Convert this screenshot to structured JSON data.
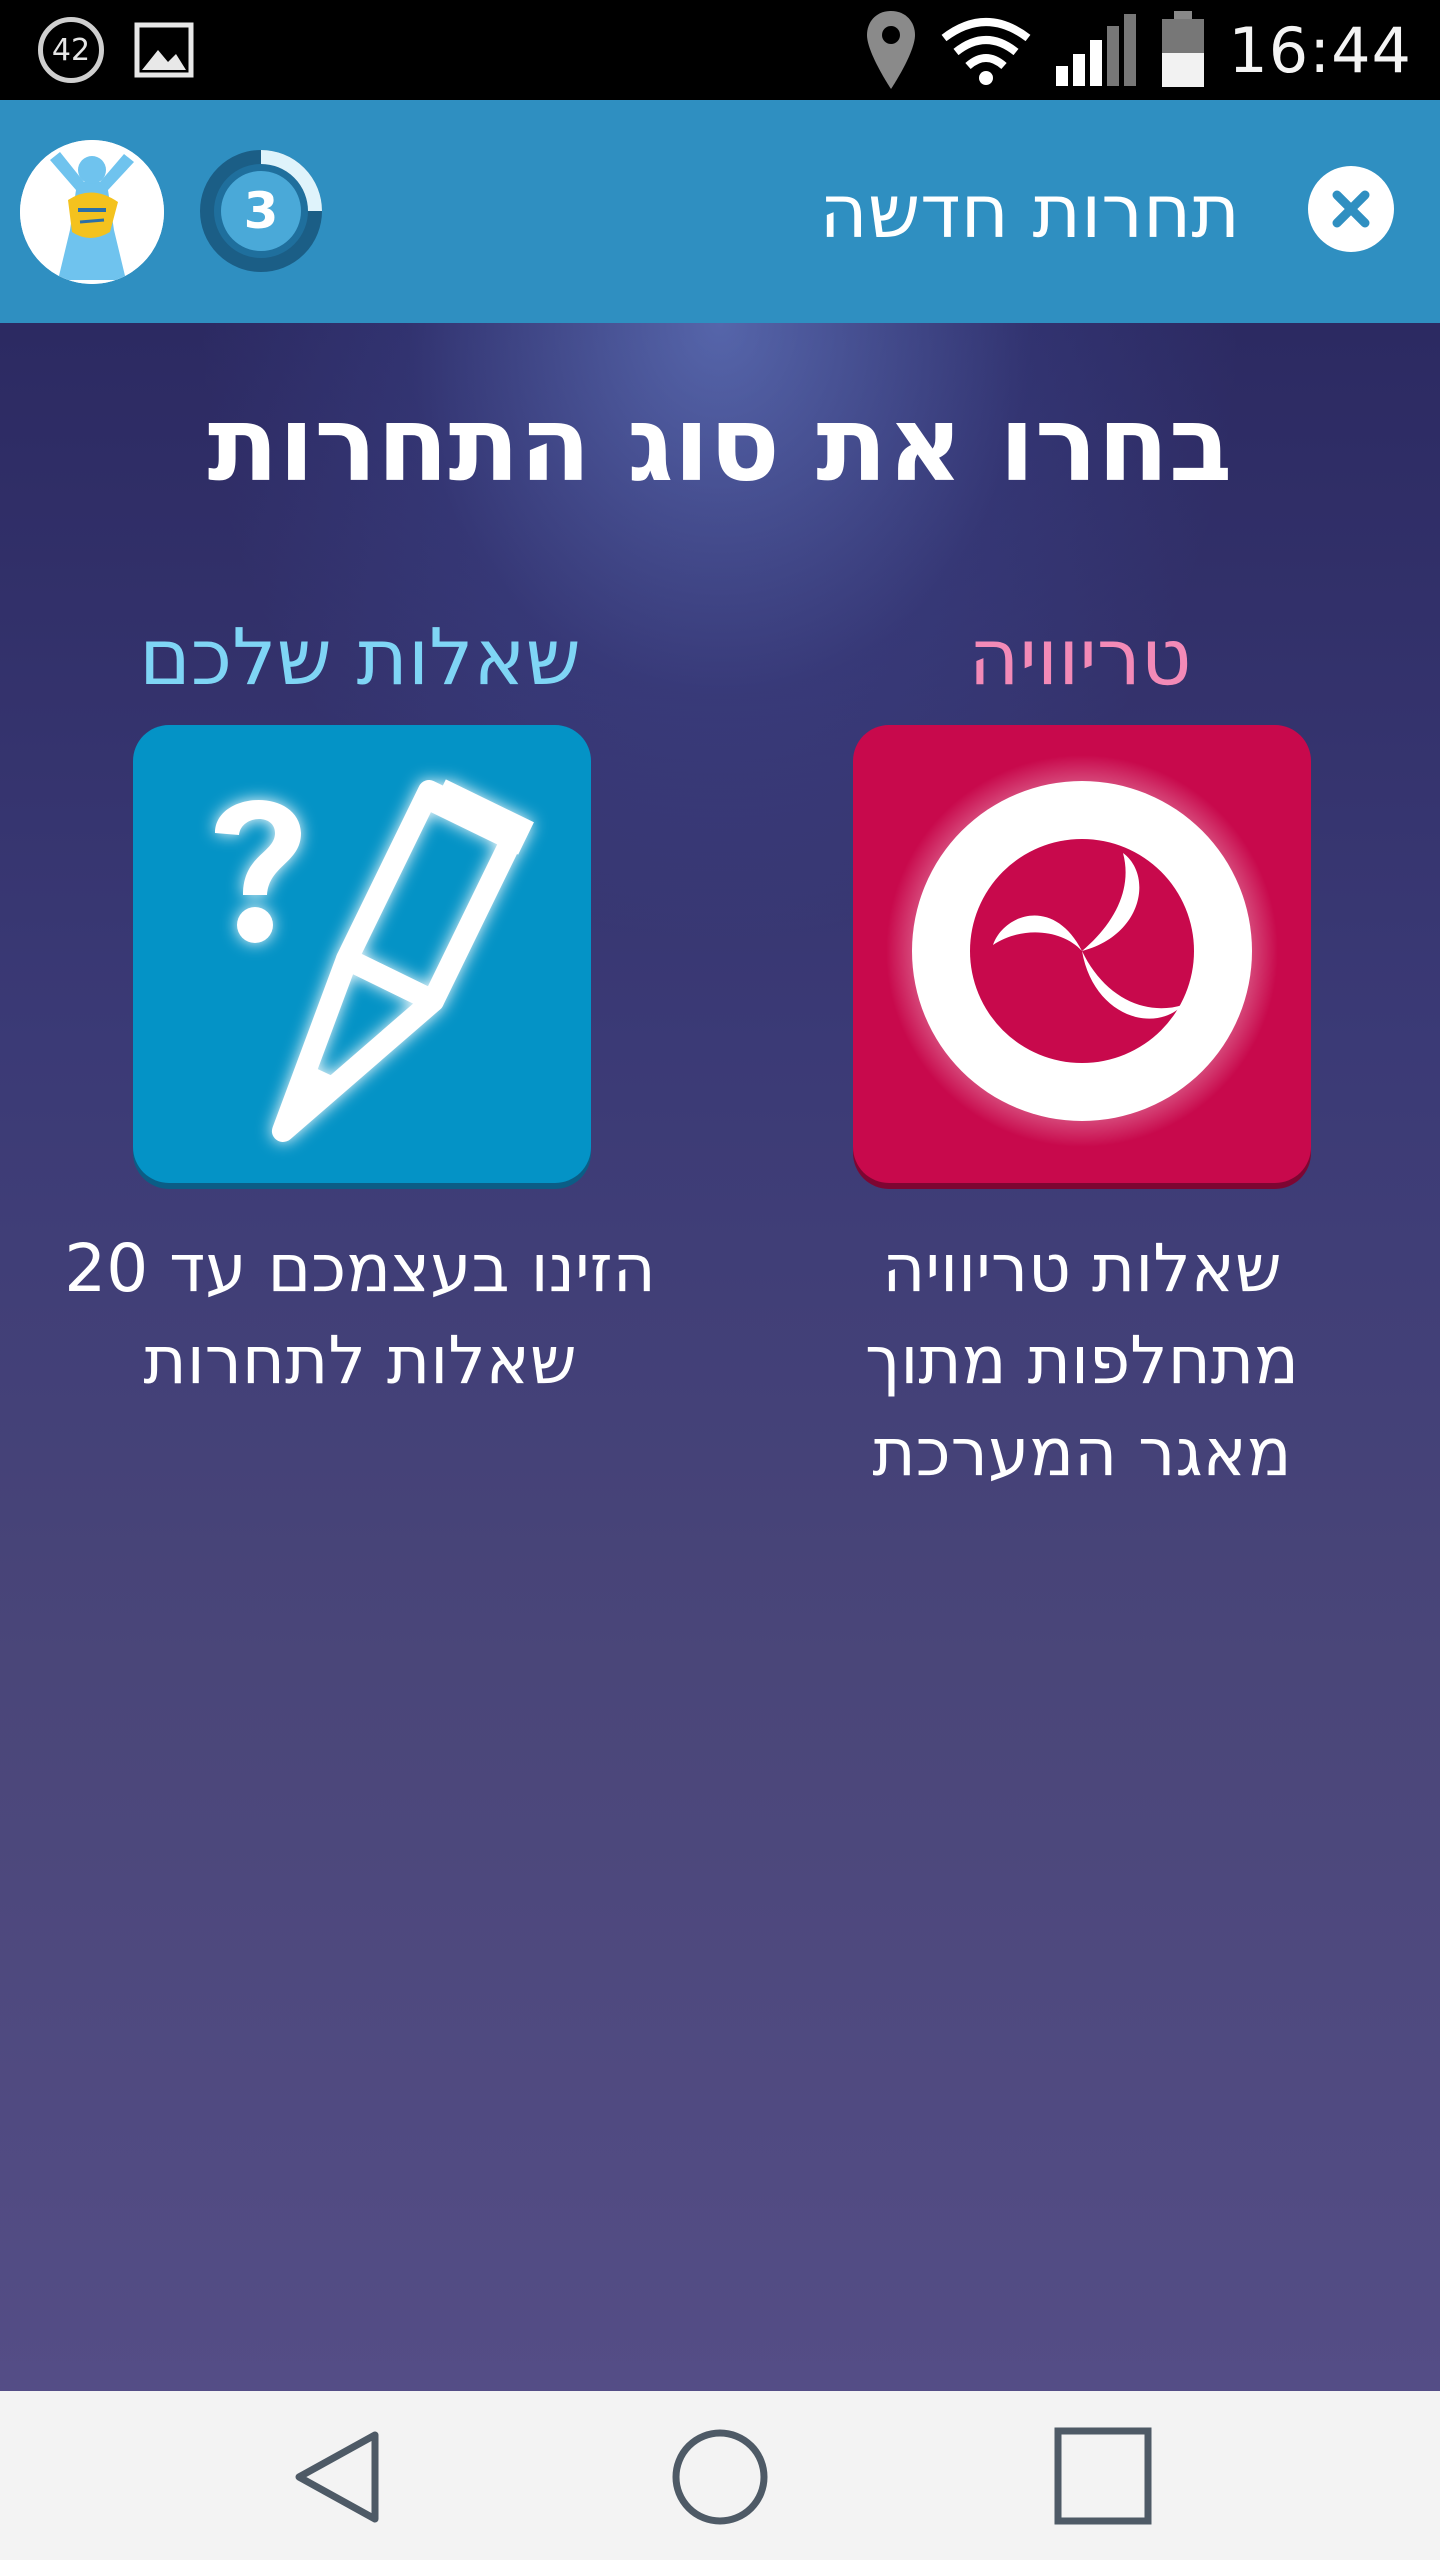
{
  "status_bar": {
    "notification_badge": "42",
    "gallery_icon": "image-icon",
    "location_icon": "location-pin-icon",
    "wifi_icon": "wifi-icon",
    "signal_icon": "cell-signal-icon",
    "battery_icon": "battery-icon",
    "time": "16:44"
  },
  "app_bar": {
    "title": "תחרות חדשה",
    "level": "3",
    "avatar_icon": "avatar-icon",
    "close_icon": "close-icon",
    "colors": {
      "bar": "#2f8fc1"
    }
  },
  "main": {
    "title": "בחרו את סוג התחרות",
    "options": [
      {
        "label": "טריוויה",
        "icon": "trivia-swirl-icon",
        "description_lines": [
          "שאלות טריוויה",
          "מתחלפות מתוך",
          "מאגר המערכת"
        ],
        "color": "#c8094c",
        "label_color": "#f38ab7"
      },
      {
        "label": "שאלות שלכם",
        "icon": "question-pencil-icon",
        "description_lines": [
          "הזינו בעצמכם עד 20",
          "שאלות לתחרות"
        ],
        "color": "#0493c6",
        "label_color": "#7fd5f5"
      }
    ]
  },
  "nav_bar": {
    "back_icon": "back-triangle-icon",
    "home_icon": "home-circle-icon",
    "recents_icon": "recents-square-icon"
  }
}
